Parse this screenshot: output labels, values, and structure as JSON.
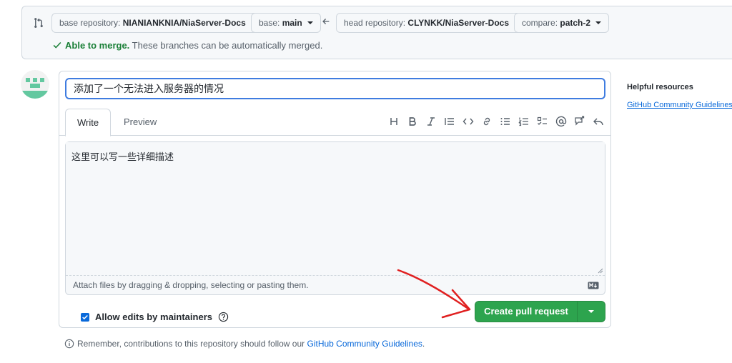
{
  "compare": {
    "base_repo_label": "base repository:",
    "base_repo_value": "NIANIANKNIA/NiaServer-Docs",
    "base_label": "base:",
    "base_value": "main",
    "head_repo_label": "head repository:",
    "head_repo_value": "CLYNKK/NiaServer-Docs",
    "compare_label": "compare:",
    "compare_value": "patch-2",
    "merge_ok": "Able to merge.",
    "merge_text": " These branches can be automatically merged."
  },
  "form": {
    "title_value": "添加了一个无法进入服务器的情况",
    "tabs": [
      {
        "label": "Write"
      },
      {
        "label": "Preview"
      }
    ],
    "toolbar_icons": [
      "heading-icon",
      "bold-icon",
      "italic-icon",
      "quote-icon",
      "code-icon",
      "link-icon",
      "unordered-list-icon",
      "ordered-list-icon",
      "task-list-icon",
      "mention-icon",
      "reference-icon",
      "reply-icon"
    ],
    "body_value": "这里可以写一些详细描述",
    "attach_text": "Attach files by dragging & dropping, selecting or pasting them.",
    "allow_edits_label": "Allow edits by maintainers",
    "create_button_label": "Create pull request"
  },
  "reminder": {
    "text": "Remember, contributions to this repository should follow our ",
    "link": "GitHub Community Guidelines",
    "suffix": "."
  },
  "sidebar": {
    "heading": "Helpful resources",
    "link": "GitHub Community Guidelines"
  },
  "colors": {
    "accent_blue": "#0969da",
    "success_green": "#2da44e",
    "annotation_red": "#e02020"
  }
}
